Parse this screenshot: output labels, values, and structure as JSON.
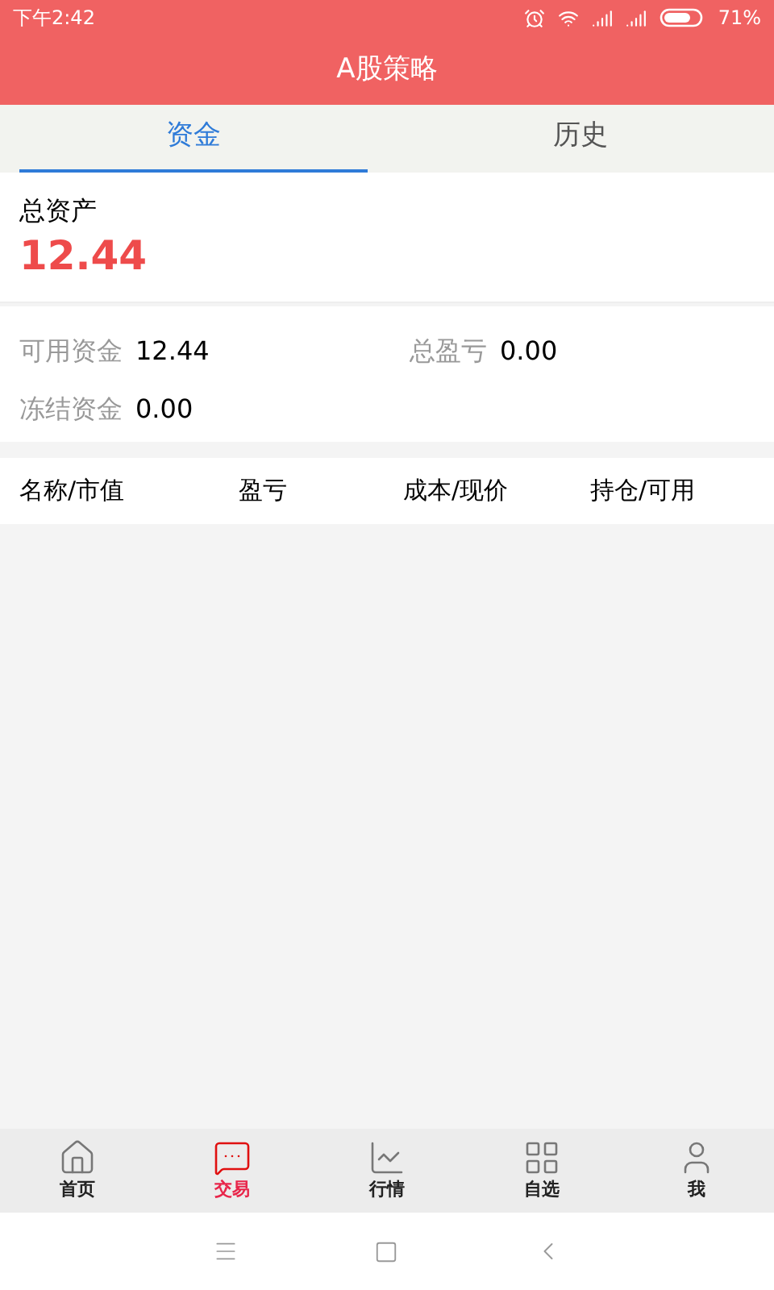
{
  "status_bar": {
    "time": "下午2:42",
    "battery": "71%"
  },
  "header": {
    "title": "A股策略"
  },
  "tabs": [
    {
      "label": "资金",
      "selected": true
    },
    {
      "label": "历史",
      "selected": false
    }
  ],
  "total_assets": {
    "label": "总资产",
    "value": "12.44"
  },
  "stats": [
    {
      "label": "可用资金",
      "value": "12.44"
    },
    {
      "label": "总盈亏",
      "value": "0.00"
    },
    {
      "label": "冻结资金",
      "value": "0.00"
    }
  ],
  "table": {
    "columns": [
      "名称/市值",
      "盈亏",
      "成本/现价",
      "持仓/可用"
    ]
  },
  "bottom_nav": [
    {
      "label": "首页",
      "kind": "home",
      "selected": false
    },
    {
      "label": "交易",
      "kind": "trade",
      "selected": true
    },
    {
      "label": "行情",
      "kind": "market",
      "selected": false
    },
    {
      "label": "自选",
      "kind": "watchlist",
      "selected": false
    },
    {
      "label": "我",
      "kind": "me",
      "selected": false
    }
  ]
}
